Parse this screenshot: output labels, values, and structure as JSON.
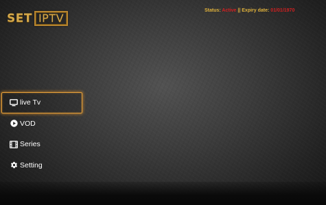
{
  "app": {
    "logo": {
      "part1": "SET",
      "part2": "IPTV"
    }
  },
  "status": {
    "status_label": "Status:",
    "status_value": "Active",
    "separator": "||",
    "expiry_label": "Expiry date:",
    "expiry_value": "01/01/1970"
  },
  "menu": {
    "items": [
      {
        "label": "live Tv",
        "icon": "tv-icon",
        "active": true
      },
      {
        "label": "VOD",
        "icon": "play-circle-icon",
        "active": false
      },
      {
        "label": "Series",
        "icon": "film-icon",
        "active": false
      },
      {
        "label": "Setting",
        "icon": "gear-icon",
        "active": false
      }
    ]
  },
  "colors": {
    "accent_gold": "#d4a84a",
    "status_label": "#e0b23c",
    "status_value": "#d22020",
    "focus_border": "#e8a13a"
  }
}
